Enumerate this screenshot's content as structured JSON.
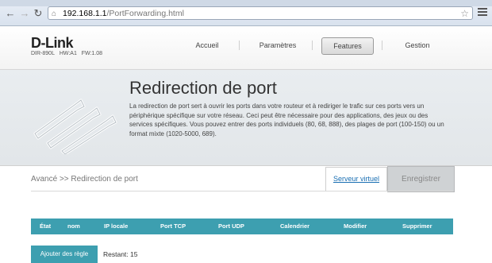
{
  "browser": {
    "url_host": "192.168.1.1",
    "url_path": "/PortForwarding.html"
  },
  "header": {
    "logo": "D-Link",
    "model": "DIR-890L",
    "hw": "HW:A1",
    "fw": "FW:1.08",
    "nav": [
      "Accueil",
      "Paramètres",
      "Features",
      "Gestion"
    ],
    "active_nav": "Features"
  },
  "banner": {
    "title": "Redirection de port",
    "description": "La redirection de port sert à ouvrir les ports dans votre routeur et à rediriger le trafic sur ces ports vers un périphérique spécifique sur votre réseau. Ceci peut être nécessaire pour des applications, des jeux ou des services spécifiques. Vous pouvez entrer des ports individuels (80, 68, 888), des plages de port (100-150) ou un format mixte (1020-5000, 689)."
  },
  "content": {
    "breadcrumb": "Avancé >> Redirection de port",
    "virtual_server_link": "Serveur virtuel",
    "save_label": "Enregistrer",
    "columns": [
      "État",
      "nom",
      "IP locale",
      "Port TCP",
      "Port UDP",
      "Calendrier",
      "Modifier",
      "Supprimer"
    ],
    "add_rule_label": "Ajouter des règle",
    "remaining": "Restant: 15"
  },
  "colors": {
    "accent": "#3d9fb0",
    "link": "#1a6fb3"
  }
}
